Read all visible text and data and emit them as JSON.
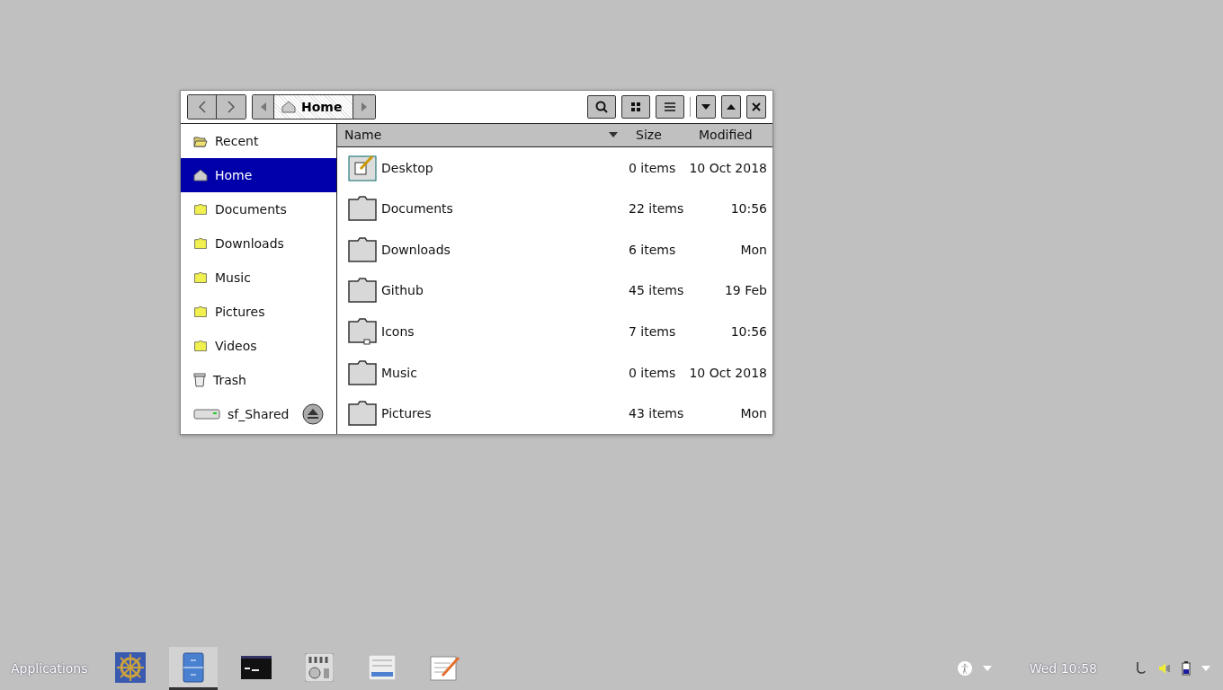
{
  "window": {
    "path": "Home"
  },
  "sidebar": {
    "items": [
      {
        "label": "Recent",
        "kind": "recent",
        "selected": false
      },
      {
        "label": "Home",
        "kind": "home",
        "selected": true
      },
      {
        "label": "Documents",
        "kind": "folder",
        "selected": false
      },
      {
        "label": "Downloads",
        "kind": "folder",
        "selected": false
      },
      {
        "label": "Music",
        "kind": "folder",
        "selected": false
      },
      {
        "label": "Pictures",
        "kind": "folder",
        "selected": false
      },
      {
        "label": "Videos",
        "kind": "folder",
        "selected": false
      },
      {
        "label": "Trash",
        "kind": "trash",
        "selected": false
      },
      {
        "label": "sf_Shared",
        "kind": "drive",
        "selected": false
      }
    ]
  },
  "table": {
    "columns": [
      {
        "label": "Name",
        "sorted": true
      },
      {
        "label": "Size",
        "sorted": false
      },
      {
        "label": "Modified",
        "sorted": false
      }
    ],
    "rows": [
      {
        "name": "Desktop",
        "kind": "desktop",
        "size": "0 items",
        "modified": "10 Oct 2018"
      },
      {
        "name": "Documents",
        "kind": "folder",
        "size": "22 items",
        "modified": "10:56"
      },
      {
        "name": "Downloads",
        "kind": "folder",
        "size": "6 items",
        "modified": "Mon"
      },
      {
        "name": "Github",
        "kind": "folder",
        "size": "45 items",
        "modified": "19 Feb"
      },
      {
        "name": "Icons",
        "kind": "link",
        "size": "7 items",
        "modified": "10:56"
      },
      {
        "name": "Music",
        "kind": "folder",
        "size": "0 items",
        "modified": "10 Oct 2018"
      },
      {
        "name": "Pictures",
        "kind": "folder",
        "size": "43 items",
        "modified": "Mon"
      }
    ]
  },
  "taskbar": {
    "menu": "Applications",
    "apps": [
      {
        "kind": "wheel",
        "selected": false
      },
      {
        "kind": "cabinet",
        "selected": true
      },
      {
        "kind": "terminal",
        "selected": false
      },
      {
        "kind": "mixer",
        "selected": false
      },
      {
        "kind": "form",
        "selected": false
      },
      {
        "kind": "editor",
        "selected": false
      }
    ],
    "clock": "Wed 10:58"
  }
}
